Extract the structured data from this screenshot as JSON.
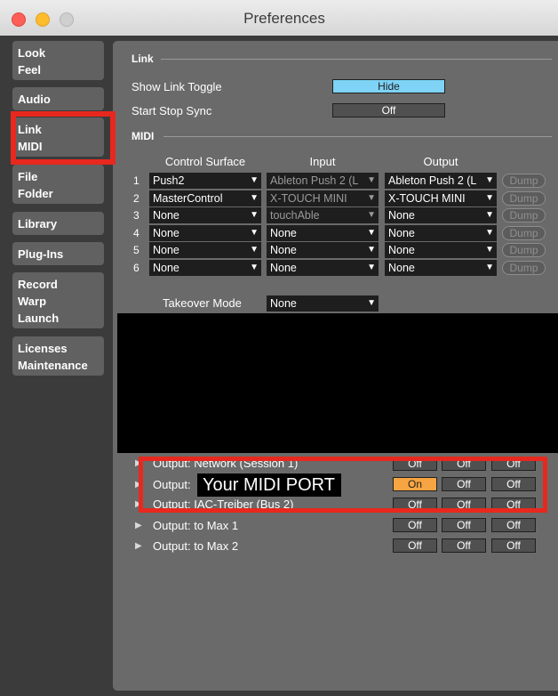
{
  "window": {
    "title": "Preferences"
  },
  "traffic_lights": {
    "close_color": "#fd5f57",
    "minimize_color": "#fdbc2e",
    "zoom_color": "#cfcfcf"
  },
  "sidebar": {
    "tabs": [
      {
        "line1": "Look",
        "line2": "Feel"
      },
      {
        "line1": "Audio",
        "line2": ""
      },
      {
        "line1": "Link",
        "line2": "MIDI"
      },
      {
        "line1": "File",
        "line2": "Folder"
      },
      {
        "line1": "Library",
        "line2": ""
      },
      {
        "line1": "Plug-Ins",
        "line2": ""
      },
      {
        "line1": "Record",
        "line2": "Warp",
        "line3": "Launch"
      },
      {
        "line1": "Licenses",
        "line2": "Maintenance"
      }
    ]
  },
  "link_section": {
    "header": "Link",
    "show_link_toggle": {
      "label": "Show Link Toggle",
      "value": "Hide"
    },
    "start_stop_sync": {
      "label": "Start Stop Sync",
      "value": "Off"
    }
  },
  "midi_section": {
    "header": "MIDI",
    "columns": {
      "control_surface": "Control Surface",
      "input": "Input",
      "output": "Output"
    },
    "rows": [
      {
        "num": "1",
        "surface": "Push2",
        "input": "Ableton Push 2 (L",
        "output": "Ableton Push 2 (L",
        "dump": "Dump"
      },
      {
        "num": "2",
        "surface": "MasterControl",
        "input": "X-TOUCH MINI",
        "output": "X-TOUCH MINI",
        "dump": "Dump"
      },
      {
        "num": "3",
        "surface": "None",
        "input": "touchAble",
        "output": "None",
        "dump": "Dump"
      },
      {
        "num": "4",
        "surface": "None",
        "input": "None",
        "output": "None",
        "dump": "Dump"
      },
      {
        "num": "5",
        "surface": "None",
        "input": "None",
        "output": "None",
        "dump": "Dump"
      },
      {
        "num": "6",
        "surface": "None",
        "input": "None",
        "output": "None",
        "dump": "Dump"
      }
    ],
    "takeover_mode": {
      "label": "Takeover Mode",
      "value": "None"
    }
  },
  "ports": [
    {
      "label": "Output:  Network (Session 1)",
      "track": "Off",
      "sync": "Off",
      "remote": "Off"
    },
    {
      "label": "Output:",
      "track": "On",
      "sync": "Off",
      "remote": "Off"
    },
    {
      "label": "Output:  IAC-Treiber (Bus 2)",
      "track": "Off",
      "sync": "Off",
      "remote": "Off"
    },
    {
      "label": "Output:  to Max 1",
      "track": "Off",
      "sync": "Off",
      "remote": "Off"
    },
    {
      "label": "Output:  to Max 2",
      "track": "Off",
      "sync": "Off",
      "remote": "Off"
    }
  ],
  "annotation": {
    "port_label": "Your MIDI PORT",
    "highlight_color": "#e8281e"
  },
  "icons": {
    "dropdown": "▼",
    "expand": "▶"
  }
}
